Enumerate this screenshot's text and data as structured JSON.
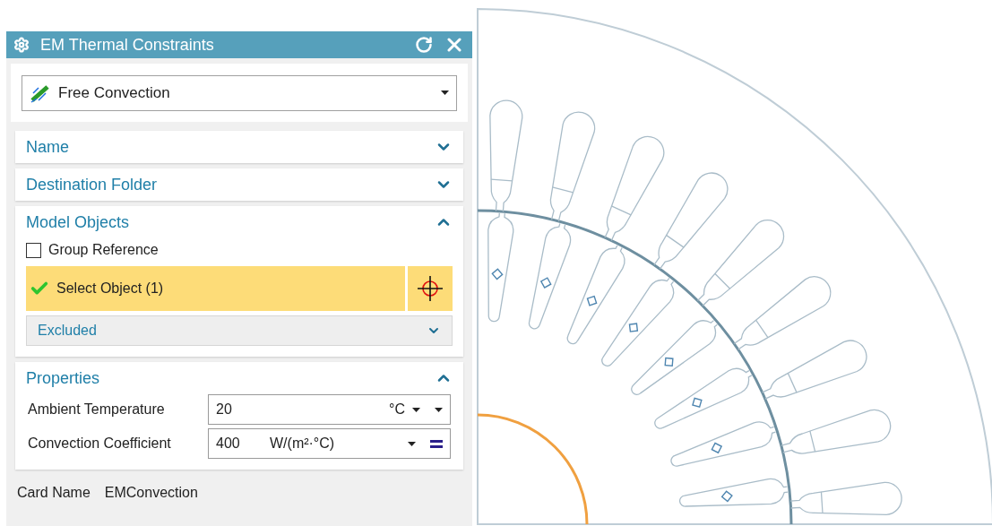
{
  "dialog": {
    "title": "EM Thermal Constraints"
  },
  "type_select": {
    "value": "Free Convection"
  },
  "sections": [
    {
      "title": "Name",
      "expanded": false
    },
    {
      "title": "Destination Folder",
      "expanded": false
    },
    {
      "kind": "objects",
      "title": "Model Objects",
      "expanded": true,
      "group_reference": {
        "label": "Group Reference",
        "checked": false
      },
      "select_object": {
        "label": "Select Object (1)",
        "complete": true
      },
      "excluded": {
        "title": "Excluded",
        "expanded": false
      }
    },
    {
      "kind": "properties",
      "title": "Properties",
      "expanded": true,
      "fields": [
        {
          "kind": "unit_menu",
          "label": "Ambient Temperature",
          "value": "20",
          "unit": "°C"
        },
        {
          "kind": "formula",
          "label": "Convection Coefficient",
          "value": "400",
          "unit": "W/(m²·°C)"
        }
      ]
    }
  ],
  "footer": {
    "label": "Card Name",
    "value": "EMConvection"
  }
}
